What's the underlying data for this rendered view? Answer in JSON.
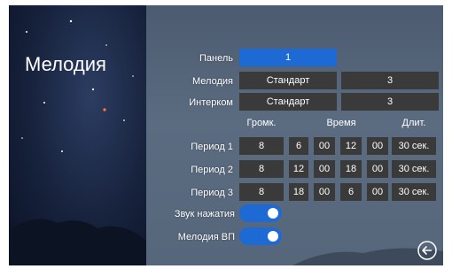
{
  "title": "Мелодия",
  "labels": {
    "panel": "Панель",
    "melody": "Мелодия",
    "intercom": "Интерком"
  },
  "values": {
    "panel": "1",
    "melody_type": "Стандарт",
    "melody_num": "3",
    "intercom_type": "Стандарт",
    "intercom_num": "3"
  },
  "headers": {
    "volume": "Громк.",
    "time": "Время",
    "duration": "Длит."
  },
  "periods": [
    {
      "label": "Период 1",
      "volume": "8",
      "start_h": "6",
      "start_m": "00",
      "end_h": "12",
      "end_m": "00",
      "duration": "30 сек."
    },
    {
      "label": "Период 2",
      "volume": "8",
      "start_h": "12",
      "start_m": "00",
      "end_h": "18",
      "end_m": "00",
      "duration": "30 сек."
    },
    {
      "label": "Период 3",
      "volume": "8",
      "start_h": "18",
      "start_m": "00",
      "end_h": "6",
      "end_m": "00",
      "duration": "30 сек."
    }
  ],
  "toggles": {
    "key_sound_label": "Звук нажатия",
    "key_sound_on": true,
    "melody_vp_label": "Мелодия ВП",
    "melody_vp_on": true
  },
  "icons": {
    "back": "back-arrow-circle-icon"
  },
  "colors": {
    "accent": "#1e6ad4",
    "field_bg": "#3a3a3a"
  }
}
